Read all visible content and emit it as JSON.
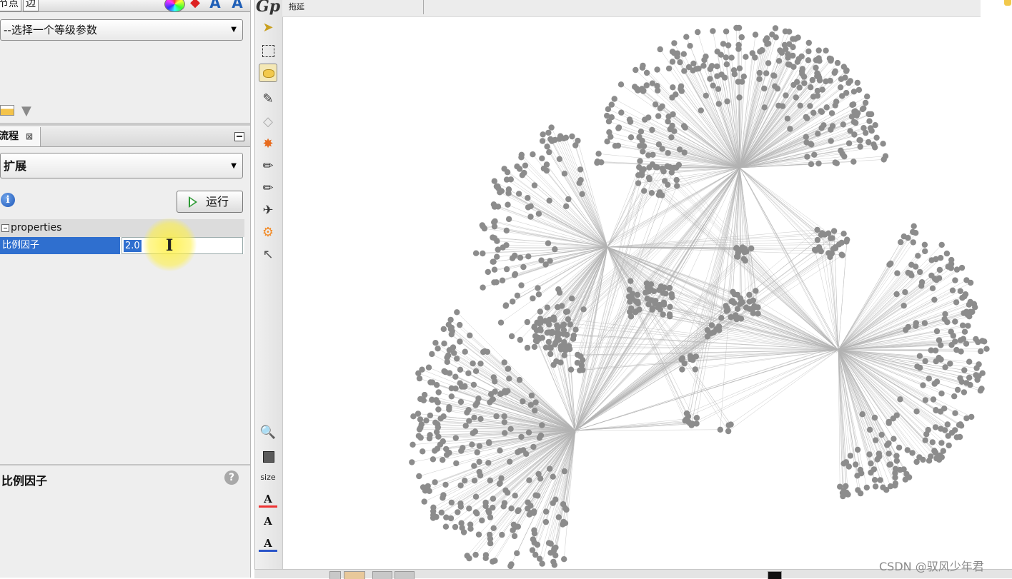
{
  "top_tabs": {
    "nodes": "节点",
    "edges": "边"
  },
  "ranking": {
    "dropdown_value": "--选择一个等级参数"
  },
  "layout_panel": {
    "tab_label": "流程",
    "tab_close": "⊠",
    "algorithm": "扩展",
    "run_label": "运行",
    "properties": {
      "group_title": "properties",
      "row_name": "比例因子",
      "row_value": "2.0"
    },
    "description_title": "比例因子",
    "help_glyph": "?",
    "info_glyph": "i"
  },
  "toolbar": {
    "size_label": "size",
    "font_glyph": "A"
  },
  "graph": {
    "mode_label": "拖延",
    "node_color": "#8c8c8c",
    "edge_color": "#9a9a9a"
  },
  "app_logo": "Gp",
  "watermark": "CSDN @驭风少年君"
}
